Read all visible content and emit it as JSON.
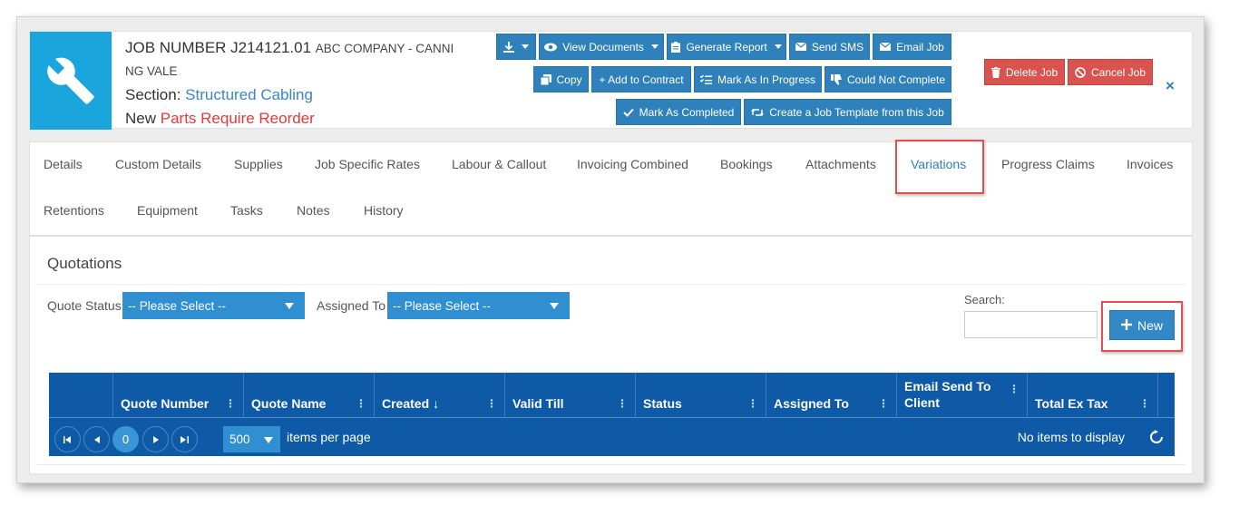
{
  "job": {
    "title_prefix": "JOB NUMBER J214121.01",
    "company_part1": "ABC COMPANY - CANNI",
    "company_part2": "NG VALE",
    "section_label": "Section:",
    "section_value": "Structured Cabling",
    "status_label": "New",
    "status_value": "Parts Require Reorder",
    "icon": "wrench-icon"
  },
  "toolbar": {
    "view_documents": "View Documents",
    "generate_report": "Generate Report",
    "send_sms": "Send SMS",
    "email_job": "Email Job",
    "copy": "Copy",
    "add_to_contract": "+ Add to Contract",
    "mark_in_progress": "Mark As In Progress",
    "could_not_complete": "Could Not Complete",
    "mark_completed": "Mark As Completed",
    "create_template": "Create a Job Template from this Job",
    "delete_job": "Delete Job",
    "cancel_job": "Cancel Job",
    "close": "×"
  },
  "tabs": [
    {
      "label": "Details"
    },
    {
      "label": "Custom Details"
    },
    {
      "label": "Supplies"
    },
    {
      "label": "Job Specific Rates"
    },
    {
      "label": "Labour & Callout"
    },
    {
      "label": "Invoicing Combined"
    },
    {
      "label": "Bookings"
    },
    {
      "label": "Attachments"
    },
    {
      "label": "Variations",
      "active": true
    },
    {
      "label": "Progress Claims"
    },
    {
      "label": "Invoices"
    },
    {
      "label": "Retentions"
    },
    {
      "label": "Equipment"
    },
    {
      "label": "Tasks"
    },
    {
      "label": "Notes"
    },
    {
      "label": "History"
    }
  ],
  "quotations": {
    "title": "Quotations",
    "quote_status_label": "Quote Status",
    "quote_status_value": "-- Please Select --",
    "assigned_to_label": "Assigned To",
    "assigned_to_value": "-- Please Select --",
    "search_label": "Search:",
    "search_value": "",
    "new_button": "New"
  },
  "grid": {
    "columns": [
      "",
      "Quote Number",
      "Quote Name",
      "Created",
      "Valid Till",
      "Status",
      "Assigned To",
      "Email Send To Client",
      "Total Ex Tax"
    ],
    "sort_indicator": "↓",
    "page_current": "0",
    "page_size": "500",
    "items_per_page_label": "items per page",
    "no_items": "No items to display"
  },
  "colors": {
    "accent": "#2f81bb",
    "danger": "#d9534f",
    "grid_header": "#0e5aa6",
    "job_icon_bg": "#1aa6dd",
    "highlight": "#e05050"
  }
}
